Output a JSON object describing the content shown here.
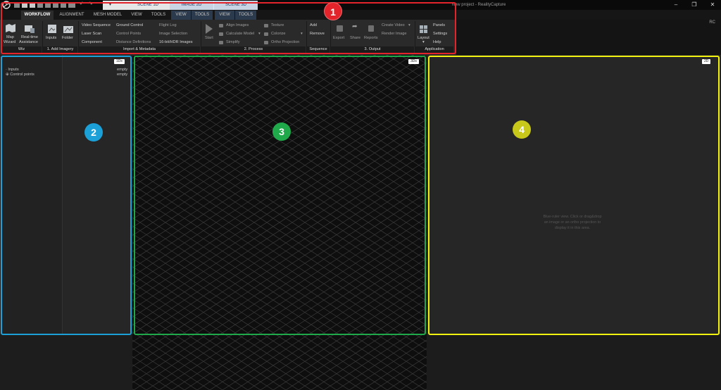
{
  "titlebar": {
    "window_title": "New project - RealityCapture",
    "scene_tabs": [
      "SCENE 1D",
      "IMAGE 2D",
      "SCENE 3D"
    ],
    "quick_access_icons": [
      "logo-icon",
      "layout-1-icon",
      "layout-2-icon",
      "layout-3-icon",
      "layout-4-icon",
      "layout-5-icon",
      "layout-6-icon",
      "layout-7-icon",
      "undo-icon",
      "redo-icon"
    ],
    "window_buttons": [
      "minimize-icon",
      "restore-icon",
      "close-icon"
    ],
    "minimize": "–",
    "restore": "❐",
    "close": "✕"
  },
  "menubar": {
    "tabs": [
      "WORKFLOW",
      "ALIGNMENT",
      "MESH MODEL",
      "VIEW",
      "TOOLS",
      "VIEW",
      "TOOLS",
      "VIEW",
      "TOOLS"
    ],
    "active": "WORKFLOW",
    "user": "RC"
  },
  "ribbon": {
    "wiz": {
      "map_wizard_1": "Map",
      "map_wizard_2": "Wizard",
      "realtime_1": "Real-time",
      "realtime_2": "Assistance",
      "group": "Wiz"
    },
    "add_imagery": {
      "inputs": "Inputs",
      "folder": "Folder",
      "group": "1. Add Imagery"
    },
    "import_metadata": {
      "col1": [
        "Video Sequence",
        "Laser Scan",
        "Component"
      ],
      "col2": [
        "Ground Control",
        "Control Points",
        "Distance Definitions"
      ],
      "col3": [
        "Flight Log",
        "Image Selection",
        "16-bit/HDR Images"
      ],
      "group": "Import & Metadata"
    },
    "process": {
      "start": "Start",
      "col1": [
        "Align Images",
        "Calculate Model",
        "Simplify"
      ],
      "col2": [
        "Texture",
        "Colorize",
        "Ortho Projection"
      ],
      "group": "2. Process"
    },
    "sequence": {
      "add": "Add",
      "remove": "Remove",
      "group": "Sequence"
    },
    "output": {
      "export": "Export",
      "share": "Share",
      "reports": "Reports",
      "create_video": "Create Video",
      "render_image": "Render Image",
      "group": "3. Output"
    },
    "application": {
      "layout": "Layout",
      "panels": "Panels",
      "settings": "Settings",
      "help": "Help",
      "group": "Application"
    }
  },
  "panels": {
    "one": {
      "tag": "1Ds",
      "tree": [
        "Inputs",
        "Control points"
      ],
      "values": [
        "empty",
        "empty"
      ]
    },
    "three": {
      "tag": "3Ds"
    },
    "four": {
      "tag": "2D",
      "message_lines": [
        "Blue-ruler view. Click or drag&drop",
        "an image or an ortho projection to",
        "display it in this area."
      ]
    }
  },
  "badges": [
    "1",
    "2",
    "3",
    "4"
  ],
  "colors": {
    "red": "#e3242b",
    "blue": "#1ba1d8",
    "green": "#1fa94b",
    "yellow": "#f2f211"
  }
}
